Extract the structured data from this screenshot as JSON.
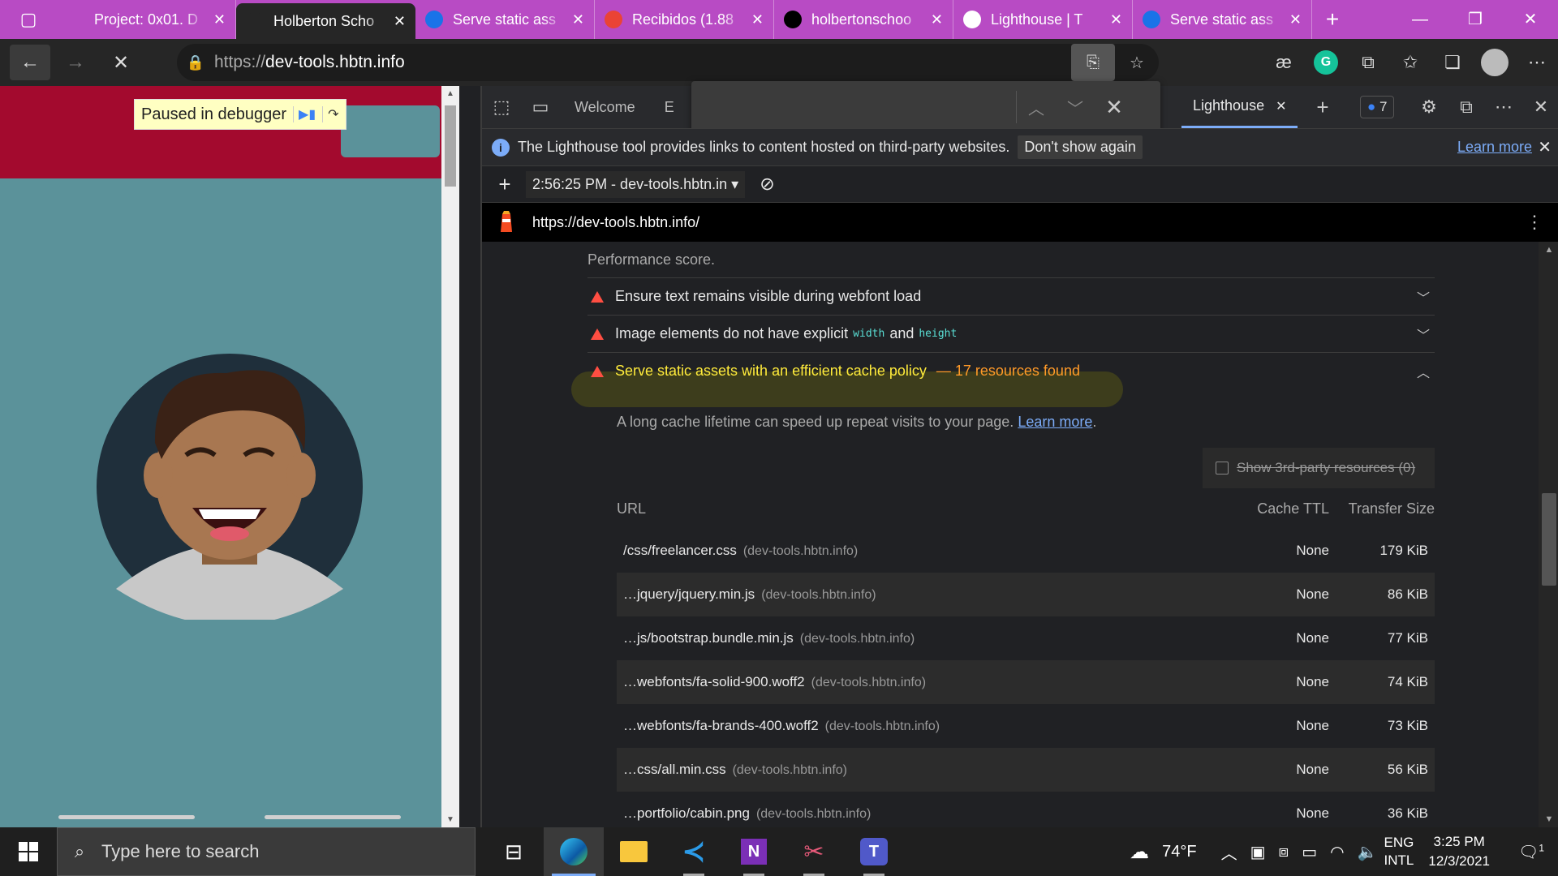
{
  "tabs": [
    {
      "title": "Project: 0x01. D",
      "fav_color": "#b84bc4",
      "icon": "seahorse-icon"
    },
    {
      "title": "Holberton Scho",
      "fav_color": "#262626",
      "icon": "loading-icon",
      "active": true
    },
    {
      "title": "Serve static ass",
      "fav_color": "#1a73e8",
      "icon": "chevron-right-icon"
    },
    {
      "title": "Recibidos (1.88",
      "fav_color": "#ea4335",
      "icon": "gmail-icon"
    },
    {
      "title": "holbertonschoo",
      "fav_color": "#000000",
      "icon": "github-icon"
    },
    {
      "title": "Lighthouse | T",
      "fav_color": "#ffffff",
      "icon": "lighthouse-icon"
    },
    {
      "title": "Serve static ass",
      "fav_color": "#1a73e8",
      "icon": "chevron-right-icon"
    }
  ],
  "address": {
    "protocol": "https://",
    "host": "dev-tools.hbtn.info"
  },
  "page": {
    "debugger_label": "Paused in debugger"
  },
  "devtools": {
    "welcome_tab": "Welcome",
    "trunc_tab": "E",
    "lighthouse_tab": "Lighthouse",
    "issues_count": "7",
    "info_message": "The Lighthouse tool provides links to content hosted on third-party websites.",
    "dont_show": "Don't show again",
    "learn_more": "Learn more",
    "report_selector": "2:56:25 PM - dev-tools.hbtn.in",
    "report_url": "https://dev-tools.hbtn.info/"
  },
  "report": {
    "perf_score_text": "Performance score.",
    "audits": [
      {
        "title": "Ensure text remains visible during webfont load"
      },
      {
        "title_pre": "Image elements do not have explicit",
        "code1": "width",
        "and": "and",
        "code2": "height"
      },
      {
        "title": "Serve static assets with an efficient cache policy",
        "found": "— 17 resources found"
      }
    ],
    "description": "A long cache lifetime can speed up repeat visits to your page.",
    "description_link": "Learn more",
    "third_party_label": "Show 3rd-party resources (0)",
    "columns": {
      "url": "URL",
      "ttl": "Cache TTL",
      "size": "Transfer Size"
    },
    "rows": [
      {
        "url": "/css/freelancer.css",
        "host": "(dev-tools.hbtn.info)",
        "ttl": "None",
        "size": "179 KiB"
      },
      {
        "url": "…jquery/jquery.min.js",
        "host": "(dev-tools.hbtn.info)",
        "ttl": "None",
        "size": "86 KiB"
      },
      {
        "url": "…js/bootstrap.bundle.min.js",
        "host": "(dev-tools.hbtn.info)",
        "ttl": "None",
        "size": "77 KiB"
      },
      {
        "url": "…webfonts/fa-solid-900.woff2",
        "host": "(dev-tools.hbtn.info)",
        "ttl": "None",
        "size": "74 KiB"
      },
      {
        "url": "…webfonts/fa-brands-400.woff2",
        "host": "(dev-tools.hbtn.info)",
        "ttl": "None",
        "size": "73 KiB"
      },
      {
        "url": "…css/all.min.css",
        "host": "(dev-tools.hbtn.info)",
        "ttl": "None",
        "size": "56 KiB"
      },
      {
        "url": "…portfolio/cabin.png",
        "host": "(dev-tools.hbtn.info)",
        "ttl": "None",
        "size": "36 KiB"
      }
    ]
  },
  "taskbar": {
    "search_placeholder": "Type here to search",
    "weather": "74°F",
    "lang1": "ENG",
    "lang2": "INTL",
    "time": "3:25 PM",
    "date": "12/3/2021",
    "notif_count": "1"
  }
}
